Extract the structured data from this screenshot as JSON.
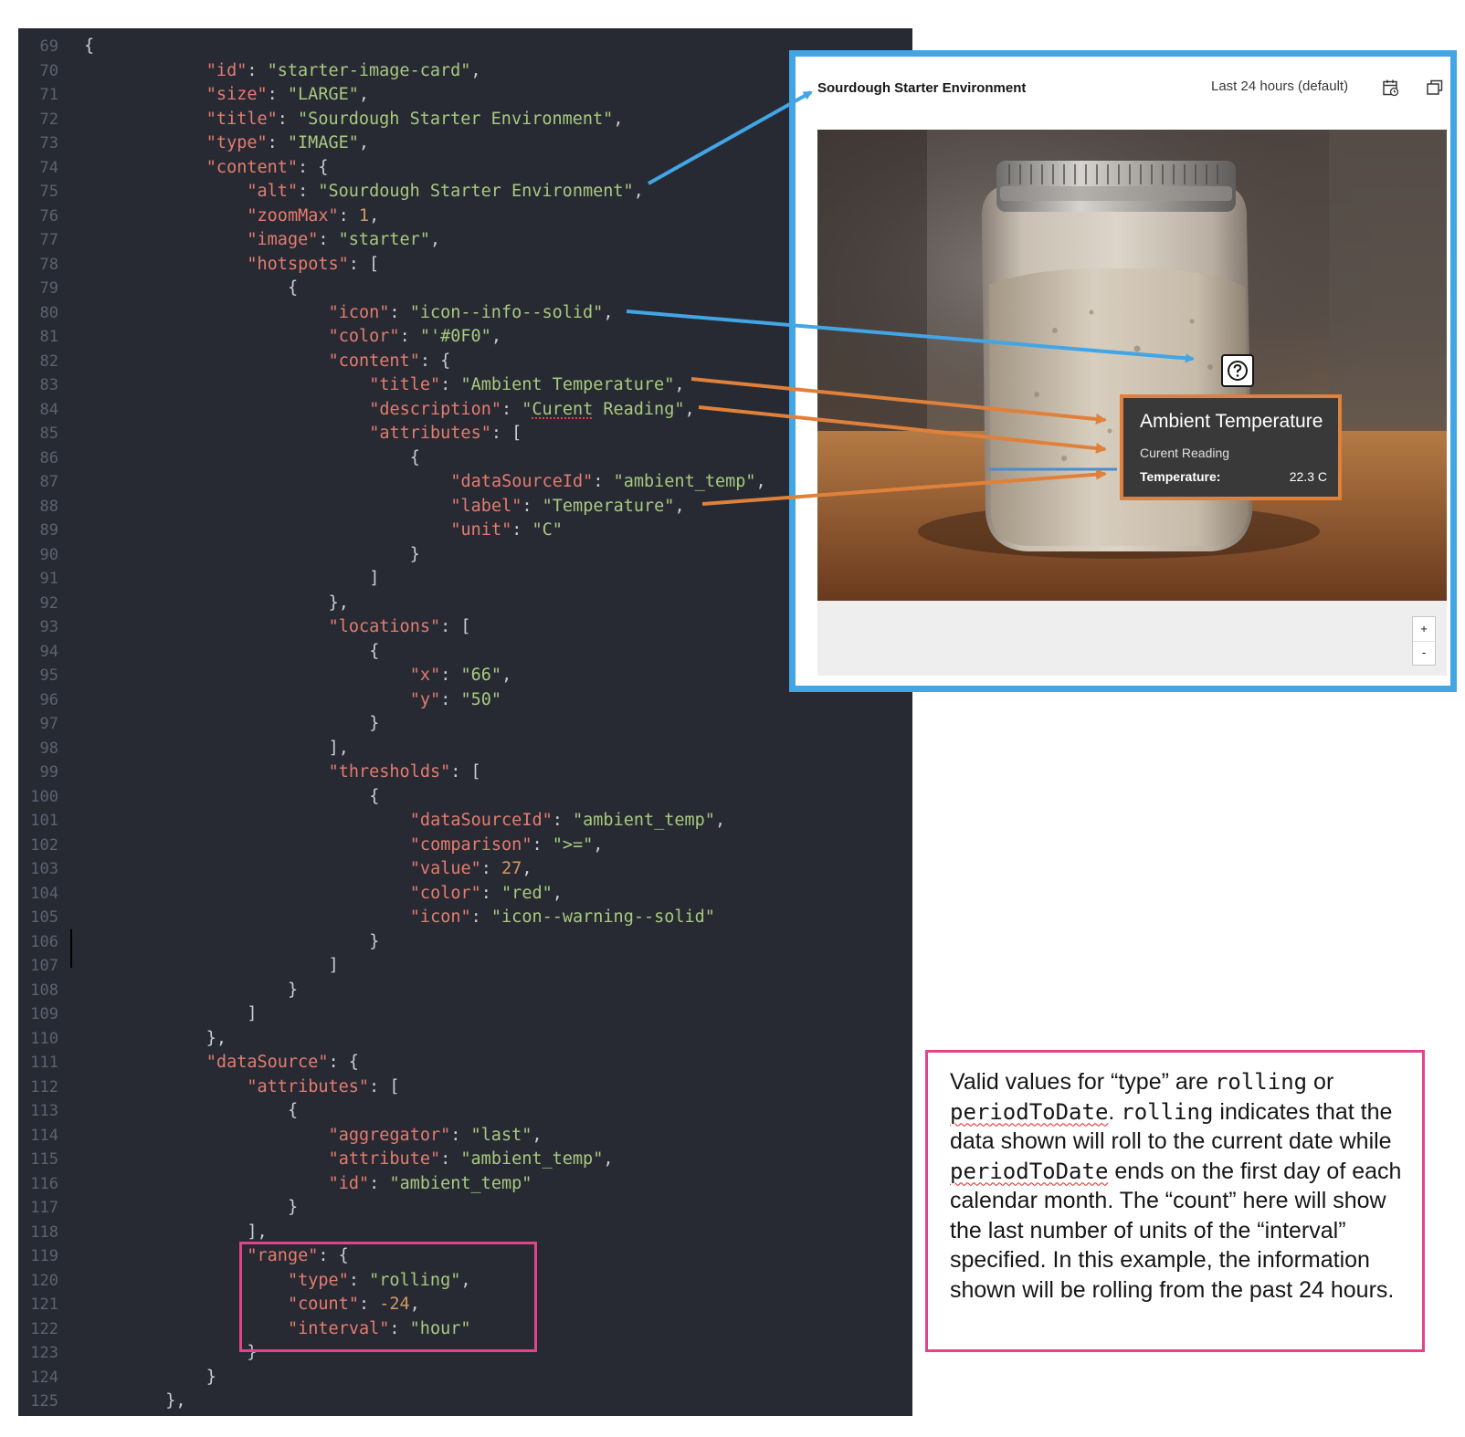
{
  "editor": {
    "lines": [
      {
        "n": "69",
        "indent": 0,
        "tokens": [
          [
            "p",
            "{"
          ]
        ]
      },
      {
        "n": "70",
        "indent": 12,
        "tokens": [
          [
            "k",
            "\"id\""
          ],
          [
            "p",
            ": "
          ],
          [
            "s",
            "\"starter-image-card\""
          ],
          [
            "p",
            ","
          ]
        ]
      },
      {
        "n": "71",
        "indent": 12,
        "tokens": [
          [
            "k",
            "\"size\""
          ],
          [
            "p",
            ": "
          ],
          [
            "s",
            "\"LARGE\""
          ],
          [
            "p",
            ","
          ]
        ]
      },
      {
        "n": "72",
        "indent": 12,
        "tokens": [
          [
            "k",
            "\"title\""
          ],
          [
            "p",
            ": "
          ],
          [
            "s",
            "\"Sourdough Starter Environment\""
          ],
          [
            "p",
            ","
          ]
        ]
      },
      {
        "n": "73",
        "indent": 12,
        "tokens": [
          [
            "k",
            "\"type\""
          ],
          [
            "p",
            ": "
          ],
          [
            "s",
            "\"IMAGE\""
          ],
          [
            "p",
            ","
          ]
        ]
      },
      {
        "n": "74",
        "indent": 12,
        "tokens": [
          [
            "k",
            "\"content\""
          ],
          [
            "p",
            ": {"
          ]
        ]
      },
      {
        "n": "75",
        "indent": 16,
        "tokens": [
          [
            "k",
            "\"alt\""
          ],
          [
            "p",
            ": "
          ],
          [
            "s",
            "\"Sourdough Starter Environment\""
          ],
          [
            "p",
            ","
          ]
        ]
      },
      {
        "n": "76",
        "indent": 16,
        "tokens": [
          [
            "k",
            "\"zoomMax\""
          ],
          [
            "p",
            ": "
          ],
          [
            "n",
            "1"
          ],
          [
            "p",
            ","
          ]
        ]
      },
      {
        "n": "77",
        "indent": 16,
        "tokens": [
          [
            "k",
            "\"image\""
          ],
          [
            "p",
            ": "
          ],
          [
            "s",
            "\"starter\""
          ],
          [
            "p",
            ","
          ]
        ]
      },
      {
        "n": "78",
        "indent": 16,
        "tokens": [
          [
            "k",
            "\"hotspots\""
          ],
          [
            "p",
            ": ["
          ]
        ]
      },
      {
        "n": "79",
        "indent": 20,
        "tokens": [
          [
            "p",
            "{"
          ]
        ]
      },
      {
        "n": "80",
        "indent": 24,
        "tokens": [
          [
            "k",
            "\"icon\""
          ],
          [
            "p",
            ": "
          ],
          [
            "s",
            "\"icon--info--solid\""
          ],
          [
            "p",
            ","
          ]
        ]
      },
      {
        "n": "81",
        "indent": 24,
        "tokens": [
          [
            "k",
            "\"color\""
          ],
          [
            "p",
            ": "
          ],
          [
            "s",
            "\"'#0F0\""
          ],
          [
            "p",
            ","
          ]
        ]
      },
      {
        "n": "82",
        "indent": 24,
        "tokens": [
          [
            "k",
            "\"content\""
          ],
          [
            "p",
            ": {"
          ]
        ]
      },
      {
        "n": "83",
        "indent": 28,
        "tokens": [
          [
            "k",
            "\"title\""
          ],
          [
            "p",
            ": "
          ],
          [
            "s",
            "\"Ambient Temperature\""
          ],
          [
            "p",
            ","
          ]
        ]
      },
      {
        "n": "84",
        "indent": 28,
        "tokens": [
          [
            "k",
            "\"description\""
          ],
          [
            "p",
            ": "
          ],
          [
            "s",
            "\""
          ],
          [
            "sq",
            "Curent"
          ],
          [
            "s",
            " Reading\""
          ],
          [
            "p",
            ","
          ]
        ]
      },
      {
        "n": "85",
        "indent": 28,
        "tokens": [
          [
            "k",
            "\"attributes\""
          ],
          [
            "p",
            ": ["
          ]
        ]
      },
      {
        "n": "86",
        "indent": 32,
        "tokens": [
          [
            "p",
            "{"
          ]
        ]
      },
      {
        "n": "87",
        "indent": 36,
        "tokens": [
          [
            "k",
            "\"dataSourceId\""
          ],
          [
            "p",
            ": "
          ],
          [
            "s",
            "\"ambient_temp\""
          ],
          [
            "p",
            ","
          ]
        ]
      },
      {
        "n": "88",
        "indent": 36,
        "tokens": [
          [
            "k",
            "\"label\""
          ],
          [
            "p",
            ": "
          ],
          [
            "s",
            "\"Temperature\""
          ],
          [
            "p",
            ","
          ]
        ]
      },
      {
        "n": "89",
        "indent": 36,
        "tokens": [
          [
            "k",
            "\"unit\""
          ],
          [
            "p",
            ": "
          ],
          [
            "s",
            "\"C\""
          ]
        ]
      },
      {
        "n": "90",
        "indent": 32,
        "tokens": [
          [
            "p",
            "}"
          ]
        ]
      },
      {
        "n": "91",
        "indent": 28,
        "tokens": [
          [
            "p",
            "]"
          ]
        ]
      },
      {
        "n": "92",
        "indent": 24,
        "tokens": [
          [
            "p",
            "},"
          ]
        ]
      },
      {
        "n": "93",
        "indent": 24,
        "tokens": [
          [
            "k",
            "\"locations\""
          ],
          [
            "p",
            ": ["
          ]
        ]
      },
      {
        "n": "94",
        "indent": 28,
        "tokens": [
          [
            "p",
            "{"
          ]
        ]
      },
      {
        "n": "95",
        "indent": 32,
        "tokens": [
          [
            "k",
            "\"x\""
          ],
          [
            "p",
            ": "
          ],
          [
            "s",
            "\"66\""
          ],
          [
            "p",
            ","
          ]
        ]
      },
      {
        "n": "96",
        "indent": 32,
        "tokens": [
          [
            "k",
            "\"y\""
          ],
          [
            "p",
            ": "
          ],
          [
            "s",
            "\"50\""
          ]
        ]
      },
      {
        "n": "97",
        "indent": 28,
        "tokens": [
          [
            "p",
            "}"
          ]
        ]
      },
      {
        "n": "98",
        "indent": 24,
        "tokens": [
          [
            "p",
            "],"
          ]
        ]
      },
      {
        "n": "99",
        "indent": 24,
        "tokens": [
          [
            "k",
            "\"thresholds\""
          ],
          [
            "p",
            ": ["
          ]
        ]
      },
      {
        "n": "100",
        "indent": 28,
        "tokens": [
          [
            "p",
            "{"
          ]
        ]
      },
      {
        "n": "101",
        "indent": 32,
        "tokens": [
          [
            "k",
            "\"dataSourceId\""
          ],
          [
            "p",
            ": "
          ],
          [
            "s",
            "\"ambient_temp\""
          ],
          [
            "p",
            ","
          ]
        ]
      },
      {
        "n": "102",
        "indent": 32,
        "tokens": [
          [
            "k",
            "\"comparison\""
          ],
          [
            "p",
            ": "
          ],
          [
            "s",
            "\">=\""
          ],
          [
            "p",
            ","
          ]
        ]
      },
      {
        "n": "103",
        "indent": 32,
        "tokens": [
          [
            "k",
            "\"value\""
          ],
          [
            "p",
            ": "
          ],
          [
            "n",
            "27"
          ],
          [
            "p",
            ","
          ]
        ]
      },
      {
        "n": "104",
        "indent": 32,
        "tokens": [
          [
            "k",
            "\"color\""
          ],
          [
            "p",
            ": "
          ],
          [
            "s",
            "\"red\""
          ],
          [
            "p",
            ","
          ]
        ]
      },
      {
        "n": "105",
        "indent": 32,
        "tokens": [
          [
            "k",
            "\"icon\""
          ],
          [
            "p",
            ": "
          ],
          [
            "s",
            "\"icon--warning--solid\""
          ]
        ]
      },
      {
        "n": "106",
        "indent": 28,
        "tokens": [
          [
            "p",
            "}"
          ]
        ]
      },
      {
        "n": "107",
        "indent": 24,
        "tokens": [
          [
            "p",
            "]"
          ]
        ]
      },
      {
        "n": "108",
        "indent": 20,
        "tokens": [
          [
            "p",
            "}"
          ]
        ]
      },
      {
        "n": "109",
        "indent": 16,
        "tokens": [
          [
            "p",
            "]"
          ]
        ]
      },
      {
        "n": "110",
        "indent": 12,
        "tokens": [
          [
            "p",
            "},"
          ]
        ]
      },
      {
        "n": "111",
        "indent": 12,
        "tokens": [
          [
            "k",
            "\"dataSource\""
          ],
          [
            "p",
            ": {"
          ]
        ]
      },
      {
        "n": "112",
        "indent": 16,
        "tokens": [
          [
            "k",
            "\"attributes\""
          ],
          [
            "p",
            ": ["
          ]
        ]
      },
      {
        "n": "113",
        "indent": 20,
        "tokens": [
          [
            "p",
            "{"
          ]
        ]
      },
      {
        "n": "114",
        "indent": 24,
        "tokens": [
          [
            "k",
            "\"aggregator\""
          ],
          [
            "p",
            ": "
          ],
          [
            "s",
            "\"last\""
          ],
          [
            "p",
            ","
          ]
        ]
      },
      {
        "n": "115",
        "indent": 24,
        "tokens": [
          [
            "k",
            "\"attribute\""
          ],
          [
            "p",
            ": "
          ],
          [
            "s",
            "\"ambient_temp\""
          ],
          [
            "p",
            ","
          ]
        ]
      },
      {
        "n": "116",
        "indent": 24,
        "tokens": [
          [
            "k",
            "\"id\""
          ],
          [
            "p",
            ": "
          ],
          [
            "s",
            "\"ambient_temp\""
          ]
        ]
      },
      {
        "n": "117",
        "indent": 20,
        "tokens": [
          [
            "p",
            "}"
          ]
        ]
      },
      {
        "n": "118",
        "indent": 16,
        "tokens": [
          [
            "p",
            "],"
          ]
        ]
      },
      {
        "n": "119",
        "indent": 16,
        "tokens": [
          [
            "k",
            "\"range\""
          ],
          [
            "p",
            ": {"
          ]
        ]
      },
      {
        "n": "120",
        "indent": 20,
        "tokens": [
          [
            "k",
            "\"type\""
          ],
          [
            "p",
            ": "
          ],
          [
            "s",
            "\"rolling\""
          ],
          [
            "p",
            ","
          ]
        ]
      },
      {
        "n": "121",
        "indent": 20,
        "tokens": [
          [
            "k",
            "\"count\""
          ],
          [
            "p",
            ": "
          ],
          [
            "n",
            "-24"
          ],
          [
            "p",
            ","
          ]
        ]
      },
      {
        "n": "122",
        "indent": 20,
        "tokens": [
          [
            "k",
            "\"interval\""
          ],
          [
            "p",
            ": "
          ],
          [
            "s",
            "\"hour\""
          ]
        ]
      },
      {
        "n": "123",
        "indent": 16,
        "tokens": [
          [
            "p",
            "}"
          ]
        ]
      },
      {
        "n": "124",
        "indent": 12,
        "tokens": [
          [
            "p",
            "}"
          ]
        ]
      },
      {
        "n": "125",
        "indent": 8,
        "tokens": [
          [
            "p",
            "},"
          ]
        ]
      }
    ]
  },
  "card": {
    "title": "Sourdough Starter Environment",
    "range_label": "Last 24 hours (default)",
    "icons": [
      "calendar-icon",
      "expand-icon"
    ],
    "hotspot_icon": "question-icon",
    "tooltip": {
      "title": "Ambient Temperature",
      "description": "Curent Reading",
      "attribute_label": "Temperature:",
      "attribute_value": "22.3 C"
    },
    "zoom_in": "+",
    "zoom_out": "-"
  },
  "note": {
    "parts": [
      [
        "t",
        "Valid values for “type” are "
      ],
      [
        "m",
        "rolling"
      ],
      [
        "t",
        " or "
      ],
      [
        "mw",
        "periodToDate"
      ],
      [
        "t",
        ". "
      ],
      [
        "m",
        "rolling"
      ],
      [
        "t",
        "  indicates that the data shown will roll to the current date while "
      ],
      [
        "mw",
        "periodToDate"
      ],
      [
        "t",
        "  ends on the first day of each calendar month. The “count” here will show the last number of units of the “interval” specified. In this example, the information shown will be rolling from the past 24 hours."
      ]
    ]
  },
  "colors": {
    "arrow_blue": "#42a5e5",
    "arrow_orange": "#e0813b",
    "highlight_pink": "#e0458c"
  }
}
